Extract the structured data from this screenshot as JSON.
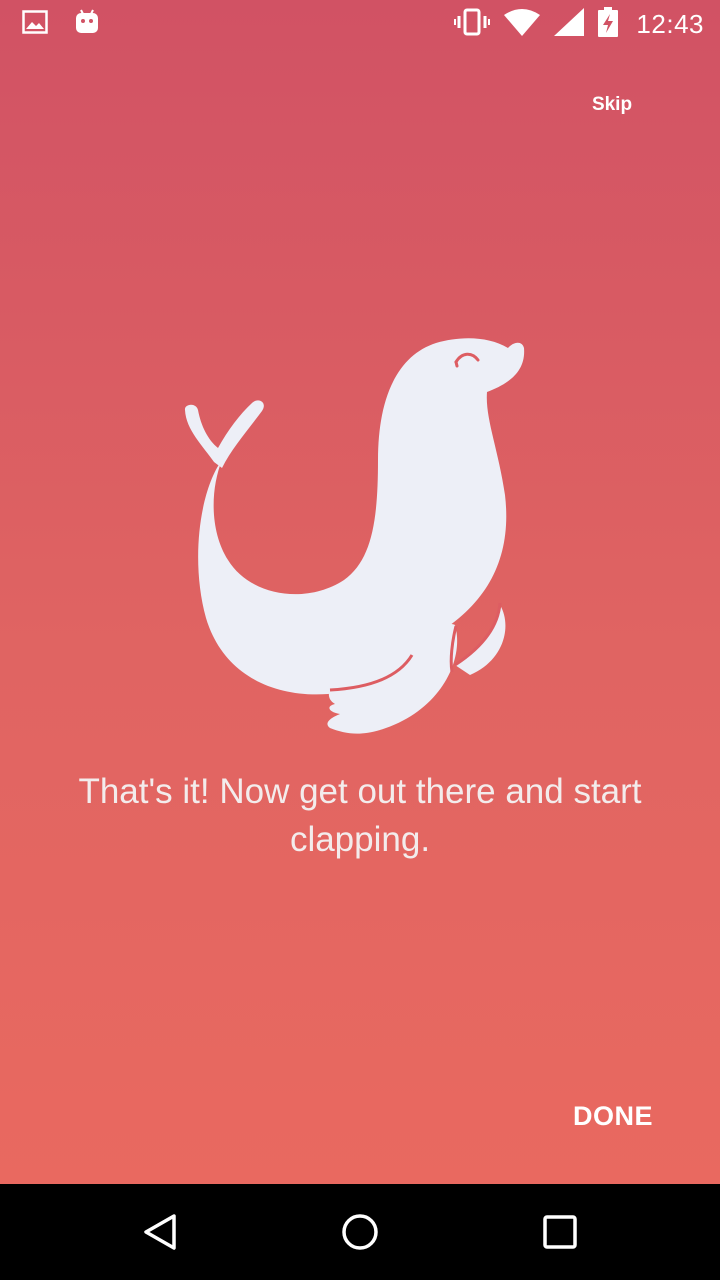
{
  "status_bar": {
    "time": "12:43",
    "icons": [
      "image-icon",
      "android-icon",
      "vibrate-icon",
      "wifi-icon",
      "signal-icon",
      "battery-charging-icon"
    ]
  },
  "header": {
    "skip_label": "Skip"
  },
  "main": {
    "illustration": "seal-icon",
    "message": "That's it! Now get out there and start clapping."
  },
  "footer": {
    "done_label": "DONE"
  },
  "nav_bar": {
    "buttons": [
      "back-icon",
      "home-icon",
      "recents-icon"
    ]
  },
  "colors": {
    "background_top": "#d15264",
    "background_bottom": "#e96960",
    "illustration": "#edeff7",
    "text": "#ffffff"
  }
}
